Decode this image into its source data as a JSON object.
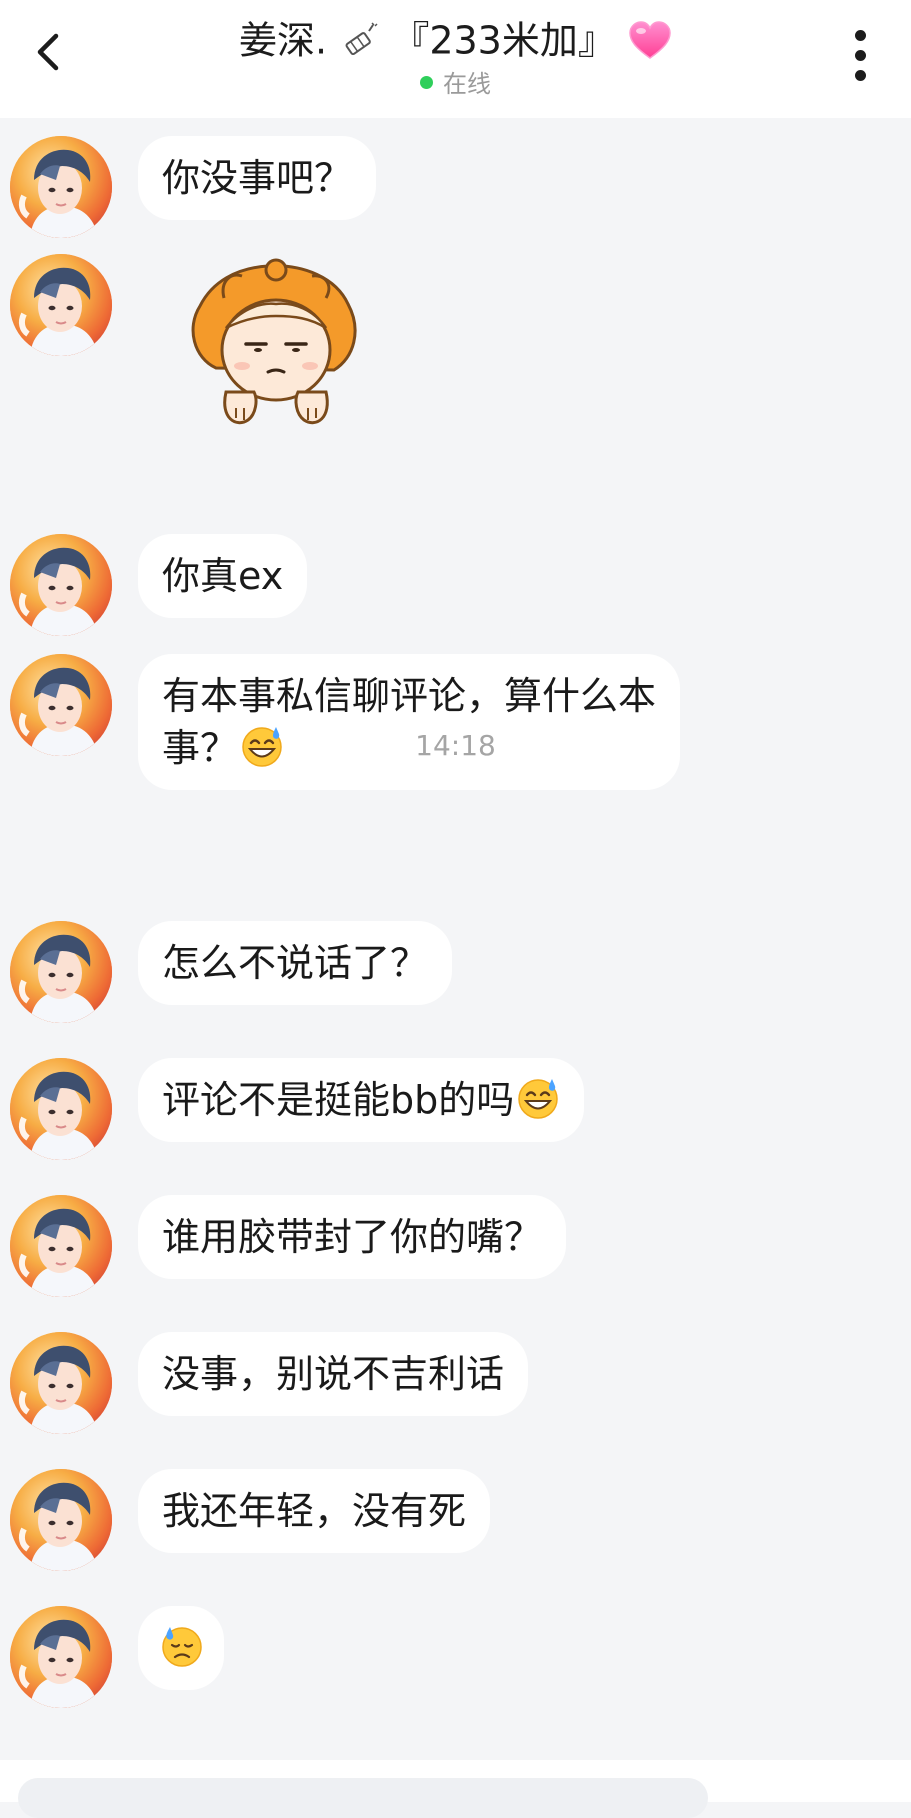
{
  "header": {
    "title": "姜深.",
    "title_tag": "『233米加』",
    "status": "在线",
    "status_color": "#2fcf5b"
  },
  "timestamp": "14:18",
  "messages": [
    {
      "type": "text",
      "text": "你没事吧？"
    },
    {
      "type": "sticker",
      "icon": "cartoon-girl-sticker"
    },
    {
      "type": "text",
      "text": "你真ex"
    },
    {
      "type": "text",
      "text": "有本事私信聊评论，算什么本\n事？",
      "emoji": "sweat-smile-emoji"
    },
    {
      "type": "text",
      "text": "怎么不说话了？"
    },
    {
      "type": "text",
      "text": "评论不是挺能bb的吗",
      "emoji": "sweat-smile-emoji"
    },
    {
      "type": "text",
      "text": "谁用胶带封了你的嘴？"
    },
    {
      "type": "text",
      "text": "没事，别说不吉利话"
    },
    {
      "type": "text",
      "text": "我还年轻，没有死"
    },
    {
      "type": "emoji",
      "emoji": "downcast-sweat-emoji"
    }
  ]
}
